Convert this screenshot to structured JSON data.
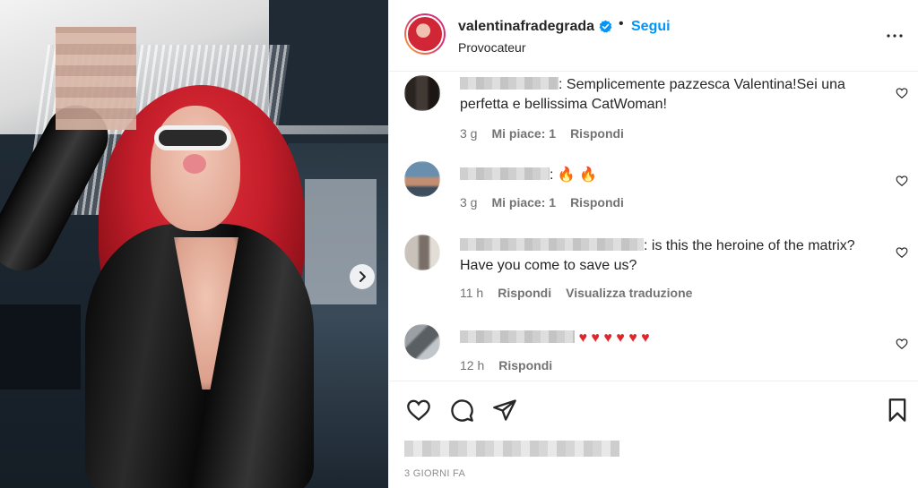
{
  "post": {
    "username": "valentinafradegrada",
    "follow_label": "Segui",
    "separator": "•",
    "subtitle": "Provocateur",
    "icons": [
      "verified-badge-icon",
      "more-options-icon",
      "chevron-right-icon"
    ]
  },
  "comments": [
    {
      "text_line1": ": Semplicemente pazzesca Valentina!Sei una",
      "text_line2": "perfetta e bellissima CatWoman!",
      "time": "3 g",
      "likes": "Mi piace: 1",
      "reply": "Rispondi"
    },
    {
      "text_line1": ":",
      "emojis": "🔥 🔥",
      "time": "3 g",
      "likes": "Mi piace: 1",
      "reply": "Rispondi"
    },
    {
      "text_line1": ": is this the heroine of the matrix?",
      "text_line2": "Have you come to save us?",
      "time": "11 h",
      "reply": "Rispondi",
      "translate": "Visualizza traduzione"
    },
    {
      "emojis": "♥ ♥ ♥ ♥ ♥ ♥",
      "time": "12 h",
      "reply": "Rispondi"
    }
  ],
  "actions": {
    "icons": [
      "heart-icon",
      "comment-icon",
      "share-icon",
      "bookmark-icon"
    ],
    "timestamp": "3 giorni fa"
  },
  "colors": {
    "accent": "#0095f6",
    "text": "#262626",
    "muted": "#737373"
  }
}
